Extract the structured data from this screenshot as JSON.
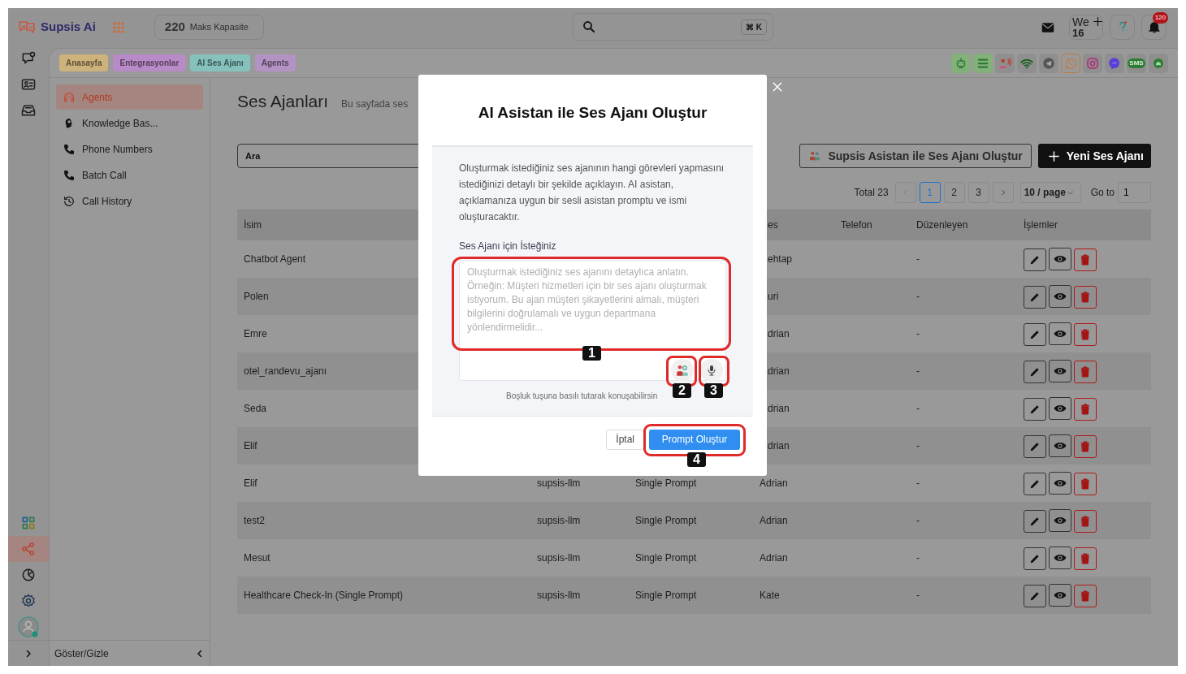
{
  "topbar": {
    "brand": "Supsis Ai",
    "capacity_value": "220",
    "capacity_label": "Maks Kapasite",
    "search_shortcut": "⌘ K",
    "date_day": "We",
    "date_number": "16",
    "notification_count": "120"
  },
  "rail": {
    "top": [
      {
        "kind": "chat",
        "selected": false
      },
      {
        "kind": "contact",
        "selected": false
      },
      {
        "kind": "inbox",
        "selected": false
      }
    ],
    "bottom": [
      {
        "kind": "apps",
        "selected": false
      },
      {
        "kind": "share",
        "selected": true
      },
      {
        "kind": "report",
        "selected": false
      },
      {
        "kind": "settings",
        "selected": false
      }
    ],
    "user_online": true
  },
  "breadcrumbs": [
    {
      "label": "Anasayfa",
      "color": "#cdb27c"
    },
    {
      "label": "Entegrasyonlar",
      "color": "#b98ac8"
    },
    {
      "label": "AI Ses Ajanı",
      "color": "#86c2bc"
    },
    {
      "label": "Agents",
      "color": "#b393c4"
    }
  ],
  "channels": [
    {
      "kind": "bot",
      "on": true,
      "selected": false
    },
    {
      "kind": "list",
      "on": true,
      "selected": false
    },
    {
      "kind": "speaker",
      "on": false,
      "selected": false
    },
    {
      "kind": "wifi",
      "on": false,
      "selected": false
    },
    {
      "kind": "telegram",
      "on": false,
      "selected": false
    },
    {
      "kind": "whatsapp",
      "on": false,
      "selected": true
    },
    {
      "kind": "instagram",
      "on": false,
      "selected": false
    },
    {
      "kind": "messenger",
      "on": false,
      "selected": false
    },
    {
      "kind": "sms",
      "label": "SMS",
      "on": false,
      "selected": false
    },
    {
      "kind": "support",
      "on": false,
      "selected": false
    }
  ],
  "sidebar": {
    "items": [
      {
        "label": "Agents",
        "kind": "agent",
        "selected": true
      },
      {
        "label": "Knowledge Bas...",
        "kind": "brain",
        "selected": false
      },
      {
        "label": "Phone Numbers",
        "kind": "phone",
        "selected": false
      },
      {
        "label": "Batch Call",
        "kind": "phone",
        "selected": false
      },
      {
        "label": "Call History",
        "kind": "history",
        "selected": false
      }
    ],
    "toggle_label": "Göster/Gizle"
  },
  "page": {
    "title": "Ses Ajanları",
    "subtitle": "Bu sayfada ses",
    "search_placeholder": "Ara",
    "assistant_button": "Supsis Asistan ile Ses Ajanı Oluştur",
    "new_button": "Yeni Ses Ajanı"
  },
  "pagination": {
    "total": "Total 23",
    "pages": [
      {
        "label": "1",
        "selected": true
      },
      {
        "label": "2",
        "selected": false
      },
      {
        "label": "3",
        "selected": false
      }
    ],
    "page_size": "10 / page",
    "goto_label": "Go to",
    "goto_value": "1"
  },
  "table": {
    "columns": [
      "İsim",
      "es",
      "Telefon",
      "Düzenleyen",
      "İşlemler"
    ],
    "rows": [
      {
        "name": "Chatbot Agent",
        "voice": "ehtap",
        "editor": "-"
      },
      {
        "name": "Polen",
        "voice": "uri",
        "editor": "-"
      },
      {
        "name": "Emre",
        "voice": "drian",
        "editor": "-"
      },
      {
        "name": "otel_randevu_ajanı",
        "voice": "drian",
        "editor": "-"
      },
      {
        "name": "Seda",
        "voice": "drian",
        "editor": "-"
      },
      {
        "name": "Elif",
        "voice": "drian",
        "editor": "-"
      },
      {
        "name": "Elif",
        "model": "supsis-llm",
        "type": "Single Prompt",
        "voice": "Adrian",
        "editor": "-"
      },
      {
        "name": "test2",
        "model": "supsis-llm",
        "type": "Single Prompt",
        "voice": "Adrian",
        "editor": "-"
      },
      {
        "name": "Mesut",
        "model": "supsis-llm",
        "type": "Single Prompt",
        "voice": "Adrian",
        "editor": "-"
      },
      {
        "name": "Healthcare Check-In (Single Prompt)",
        "model": "supsis-llm",
        "type": "Single Prompt",
        "voice": "Kate",
        "editor": "-"
      }
    ]
  },
  "modal": {
    "title": "AI Asistan ile Ses Ajanı Oluştur",
    "description": "Oluşturmak istediğiniz ses ajanının hangi görevleri yapmasını istediğinizi detaylı bir şekilde açıklayın. AI asistan, açıklamanıza uygun bir sesli asistan promptu ve ismi oluşturacaktır.",
    "field_label": "Ses Ajanı için İsteğiniz",
    "placeholder": "Oluşturmak istediğiniz ses ajanını detaylıca anlatın. Örneğin: Müşteri hizmetleri için bir ses ajanı oluşturmak istiyorum. Bu ajan müşteri şikayetlerini almalı, müşteri bilgilerini doğrulamalı ve uygun departmana yönlendirmelidir...",
    "field_annotation": "1",
    "persona_annotation": "2",
    "mic_annotation": "3",
    "hint": "Boşluk tuşuna basılı tutarak konuşabilirsin",
    "cancel": "İptal",
    "submit": "Prompt Oluştur",
    "submit_annotation": "4"
  }
}
